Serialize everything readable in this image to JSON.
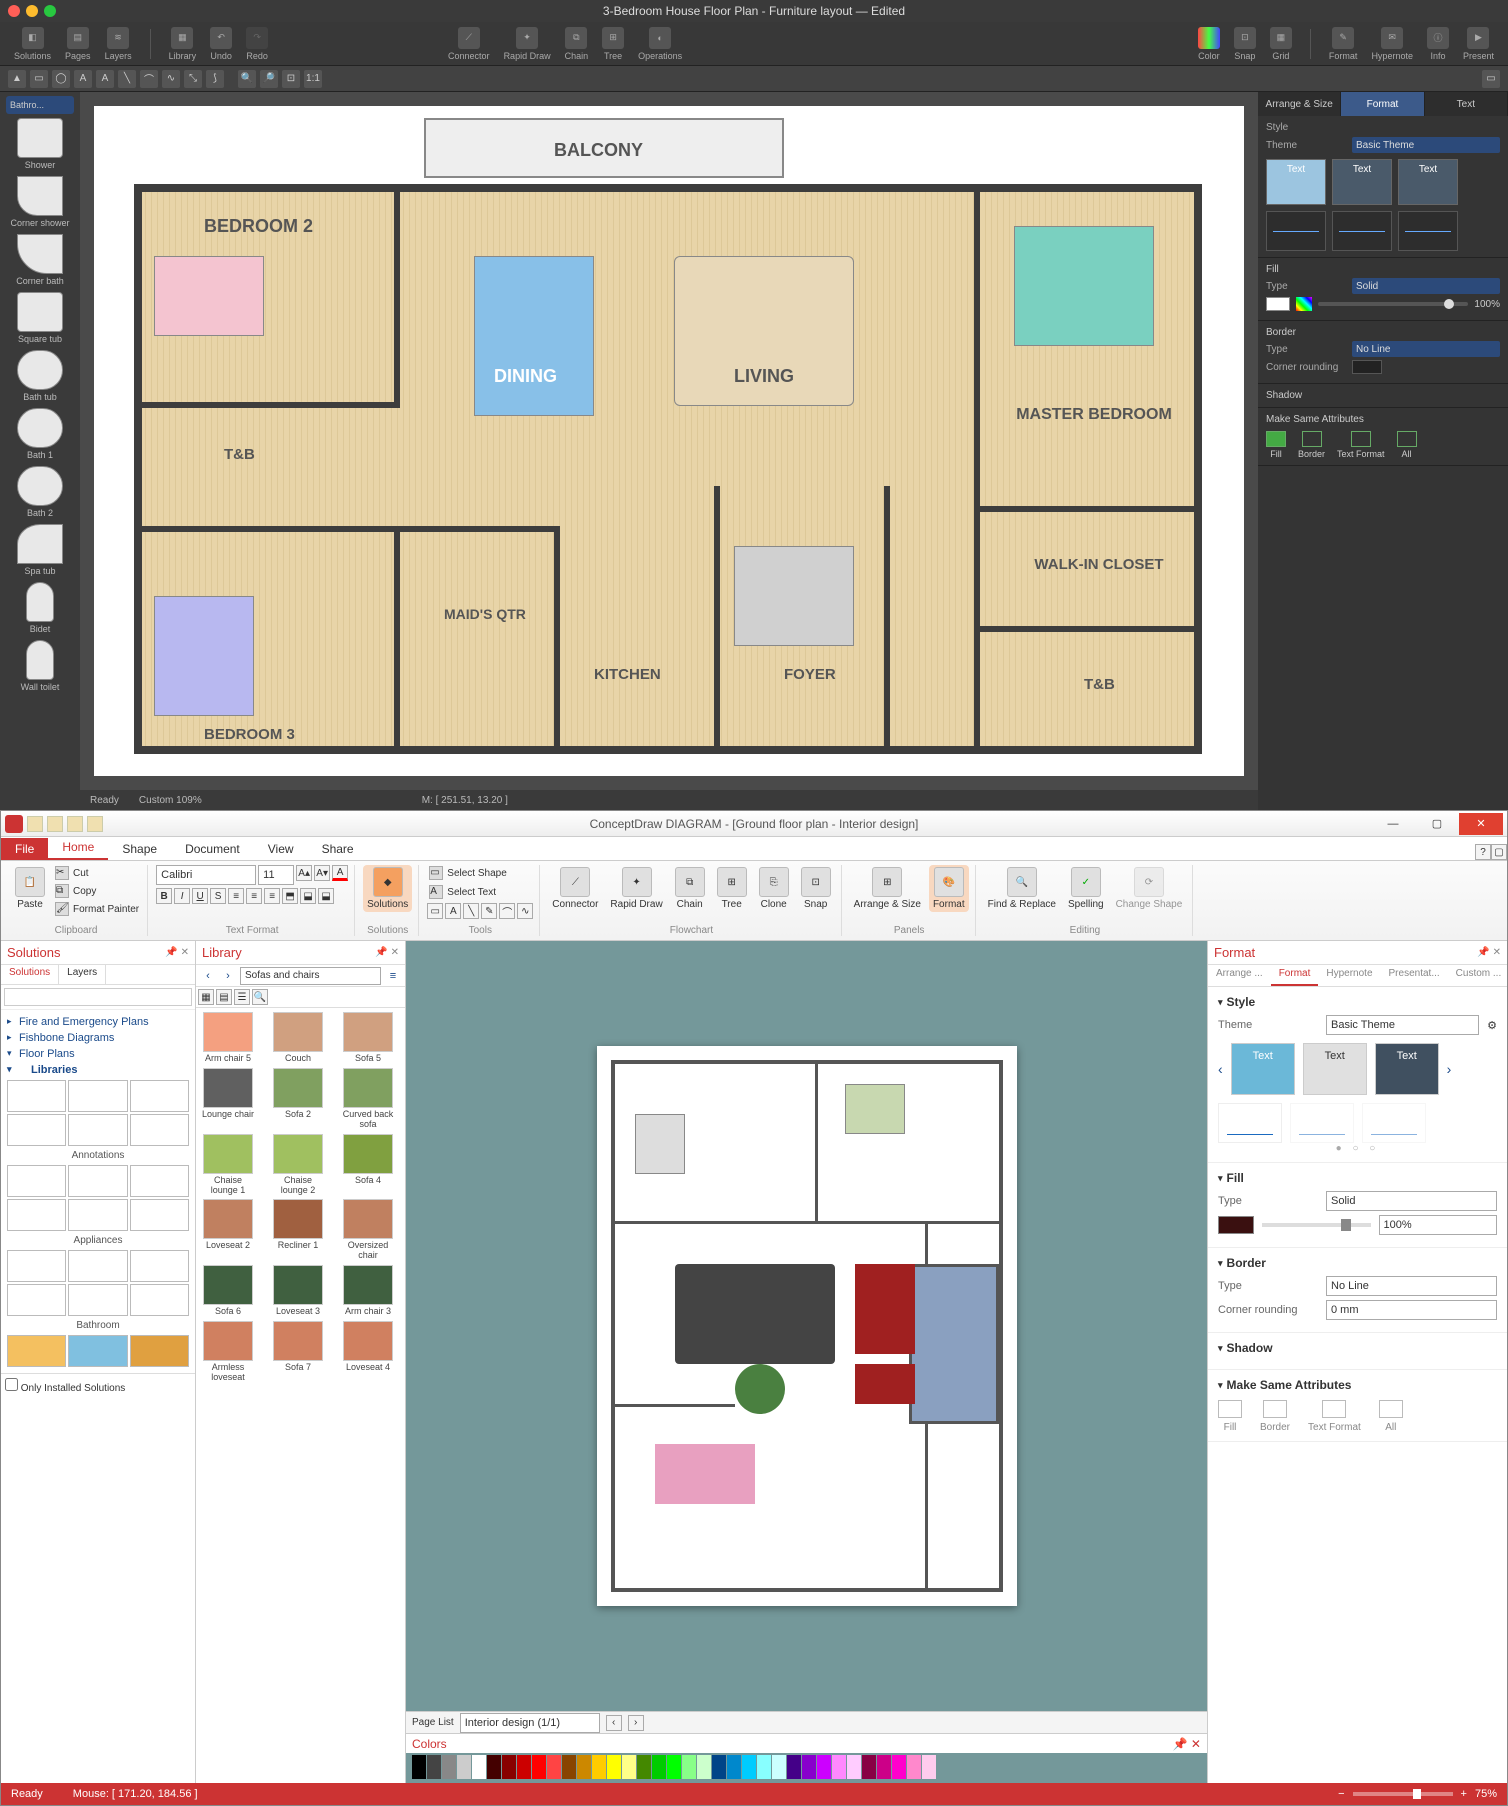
{
  "top": {
    "title": "3-Bedroom House Floor Plan - Furniture layout — Edited",
    "toolbar": {
      "solutions": "Solutions",
      "pages": "Pages",
      "layers": "Layers",
      "library": "Library",
      "undo": "Undo",
      "redo": "Redo",
      "connector": "Connector",
      "rapid": "Rapid Draw",
      "chain": "Chain",
      "tree": "Tree",
      "operations": "Operations",
      "color": "Color",
      "snap": "Snap",
      "grid": "Grid",
      "format": "Format",
      "hypernote": "Hypernote",
      "info": "Info",
      "present": "Present"
    },
    "sidebar_select": "Bathro...",
    "shapes": [
      "Shower",
      "Corner shower",
      "Corner bath",
      "Square tub",
      "Bath tub",
      "Bath 1",
      "Bath 2",
      "Spa tub",
      "Bidet",
      "Wall toilet"
    ],
    "canvas_labels": {
      "balcony": "BALCONY",
      "bed2": "BEDROOM 2",
      "dining": "DINING",
      "living": "LIVING",
      "master": "MASTER BEDROOM",
      "walkin": "WALK-IN CLOSET",
      "tnb1": "T&B",
      "tnb2": "T&B",
      "maids": "MAID'S QTR",
      "kitchen": "KITCHEN",
      "foyer": "FOYER",
      "bed3": "BEDROOM 3"
    },
    "footer": {
      "ready": "Ready",
      "zoom": "Custom 109%",
      "mouse": "M: [ 251.51, 13.20 ]"
    },
    "right": {
      "tabs": {
        "arrange": "Arrange & Size",
        "format": "Format",
        "text": "Text"
      },
      "style": "Style",
      "theme_lbl": "Theme",
      "theme_val": "Basic Theme",
      "card_text": "Text",
      "fill": "Fill",
      "type_lbl": "Type",
      "fill_val": "Solid",
      "opacity": "100%",
      "border": "Border",
      "border_val": "No Line",
      "corner": "Corner rounding",
      "shadow": "Shadow",
      "make_same": "Make Same Attributes",
      "attrs": {
        "fill": "Fill",
        "border": "Border",
        "text": "Text Format",
        "all": "All"
      }
    }
  },
  "bot": {
    "title": "ConceptDraw DIAGRAM - [Ground floor plan - Interior design]",
    "ribbon_tabs": {
      "file": "File",
      "home": "Home",
      "shape": "Shape",
      "document": "Document",
      "view": "View",
      "share": "Share"
    },
    "clipboard": {
      "paste": "Paste",
      "cut": "Cut",
      "copy": "Copy",
      "fmt": "Format Painter",
      "label": "Clipboard"
    },
    "font": {
      "name": "Calibri",
      "size": "11",
      "label": "Text Format"
    },
    "solutions": {
      "btn": "Solutions",
      "label": "Solutions"
    },
    "shape_grp": {
      "select_shape": "Select Shape",
      "select_text": "Select Text",
      "label": "Tools"
    },
    "flow": {
      "connector": "Connector",
      "rapid": "Rapid Draw",
      "chain": "Chain",
      "tree": "Tree",
      "clone": "Clone",
      "snap": "Snap",
      "label": "Flowchart"
    },
    "panels": {
      "arrange": "Arrange & Size",
      "format": "Format",
      "label": "Panels"
    },
    "edit": {
      "find": "Find & Replace",
      "spell": "Spelling",
      "change": "Change Shape",
      "label": "Editing"
    },
    "left": {
      "hdr": "Solutions",
      "tabs": {
        "solutions": "Solutions",
        "layers": "Layers"
      },
      "search_ph": "",
      "tree": [
        "Fire and Emergency Plans",
        "Fishbone Diagrams",
        "Floor Plans"
      ],
      "libraries": "Libraries",
      "groups": [
        "Annotations",
        "Appliances",
        "Bathroom"
      ],
      "only_installed": "Only Installed Solutions"
    },
    "lib": {
      "hdr": "Library",
      "combo": "Sofas and chairs",
      "items": [
        "Arm chair 5",
        "Couch",
        "Sofa 5",
        "Lounge chair",
        "Sofa 2",
        "Curved back sofa",
        "Chaise lounge 1",
        "Chaise lounge 2",
        "Sofa 4",
        "Loveseat 2",
        "Recliner 1",
        "Oversized chair",
        "Sofa 6",
        "Loveseat 3",
        "Arm chair 3",
        "Armless loveseat",
        "Sofa 7",
        "Loveseat 4"
      ]
    },
    "canvas": {
      "page_list": "Page List",
      "page_combo": "Interior design (1/1)",
      "colors_hdr": "Colors"
    },
    "right": {
      "hdr": "Format",
      "tabs": [
        "Arrange ...",
        "Format",
        "Hypernote",
        "Presentat...",
        "Custom ..."
      ],
      "style": "Style",
      "theme_lbl": "Theme",
      "theme_val": "Basic Theme",
      "gear": "⚙",
      "card_text": "Text",
      "fill": "Fill",
      "type_lbl": "Type",
      "fill_val": "Solid",
      "opacity": "100%",
      "border": "Border",
      "border_val": "No Line",
      "corner_lbl": "Corner rounding",
      "corner_val": "0 mm",
      "shadow": "Shadow",
      "make_same": "Make Same Attributes",
      "attrs": {
        "fill": "Fill",
        "border": "Border",
        "text": "Text Format",
        "all": "All"
      }
    },
    "status": {
      "ready": "Ready",
      "mouse": "Mouse: [ 171.20, 184.56 ]",
      "zoom": "75%"
    }
  },
  "palette": [
    "#000",
    "#444",
    "#888",
    "#ccc",
    "#fff",
    "#400",
    "#800",
    "#c00",
    "#f00",
    "#f44",
    "#840",
    "#c80",
    "#fc0",
    "#ff0",
    "#ff8",
    "#480",
    "#0c0",
    "#0f0",
    "#8f8",
    "#cfc",
    "#048",
    "#08c",
    "#0cf",
    "#8ff",
    "#cff",
    "#408",
    "#80c",
    "#c0f",
    "#f8f",
    "#fcf",
    "#804",
    "#c08",
    "#f0c",
    "#f8c",
    "#fce"
  ]
}
